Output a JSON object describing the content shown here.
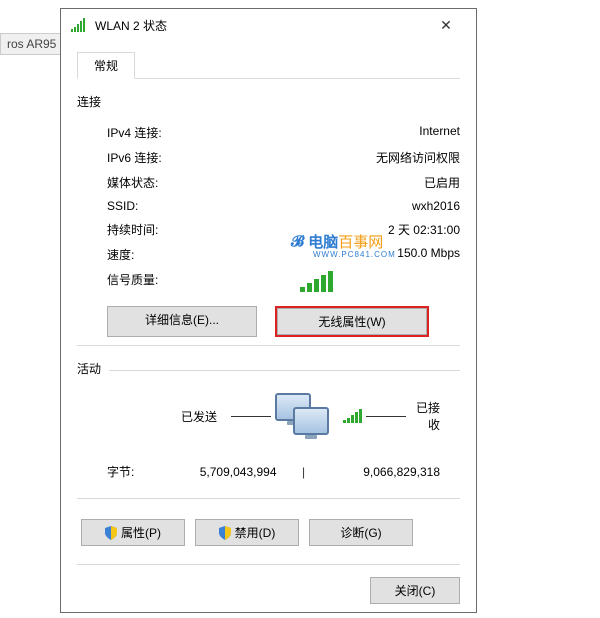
{
  "background_button": "ros AR95",
  "dialog": {
    "title": "WLAN 2 状态",
    "tab": "常规",
    "connection": {
      "section": "连接",
      "rows": {
        "ipv4": {
          "label": "IPv4 连接:",
          "value": "Internet"
        },
        "ipv6": {
          "label": "IPv6 连接:",
          "value": "无网络访问权限"
        },
        "media": {
          "label": "媒体状态:",
          "value": "已启用"
        },
        "ssid": {
          "label": "SSID:",
          "value": "wxh2016"
        },
        "duration": {
          "label": "持续时间:",
          "value": "2 天 02:31:00"
        },
        "speed": {
          "label": "速度:",
          "value": "150.0 Mbps"
        },
        "signal": {
          "label": "信号质量:"
        }
      },
      "buttons": {
        "details": "详细信息(E)...",
        "wireless_props": "无线属性(W)"
      }
    },
    "activity": {
      "section": "活动",
      "sent": "已发送",
      "received": "已接收",
      "bytes_label": "字节:",
      "bytes_sent": "5,709,043,994",
      "bytes_received": "9,066,829,318"
    },
    "bottom_buttons": {
      "properties": "属性(P)",
      "disable": "禁用(D)",
      "diagnose": "诊断(G)"
    },
    "close_button": "关闭(C)"
  },
  "watermark": {
    "brand1": "电脑",
    "brand2": "百事网",
    "sub": "WWW.PC841.COM"
  }
}
